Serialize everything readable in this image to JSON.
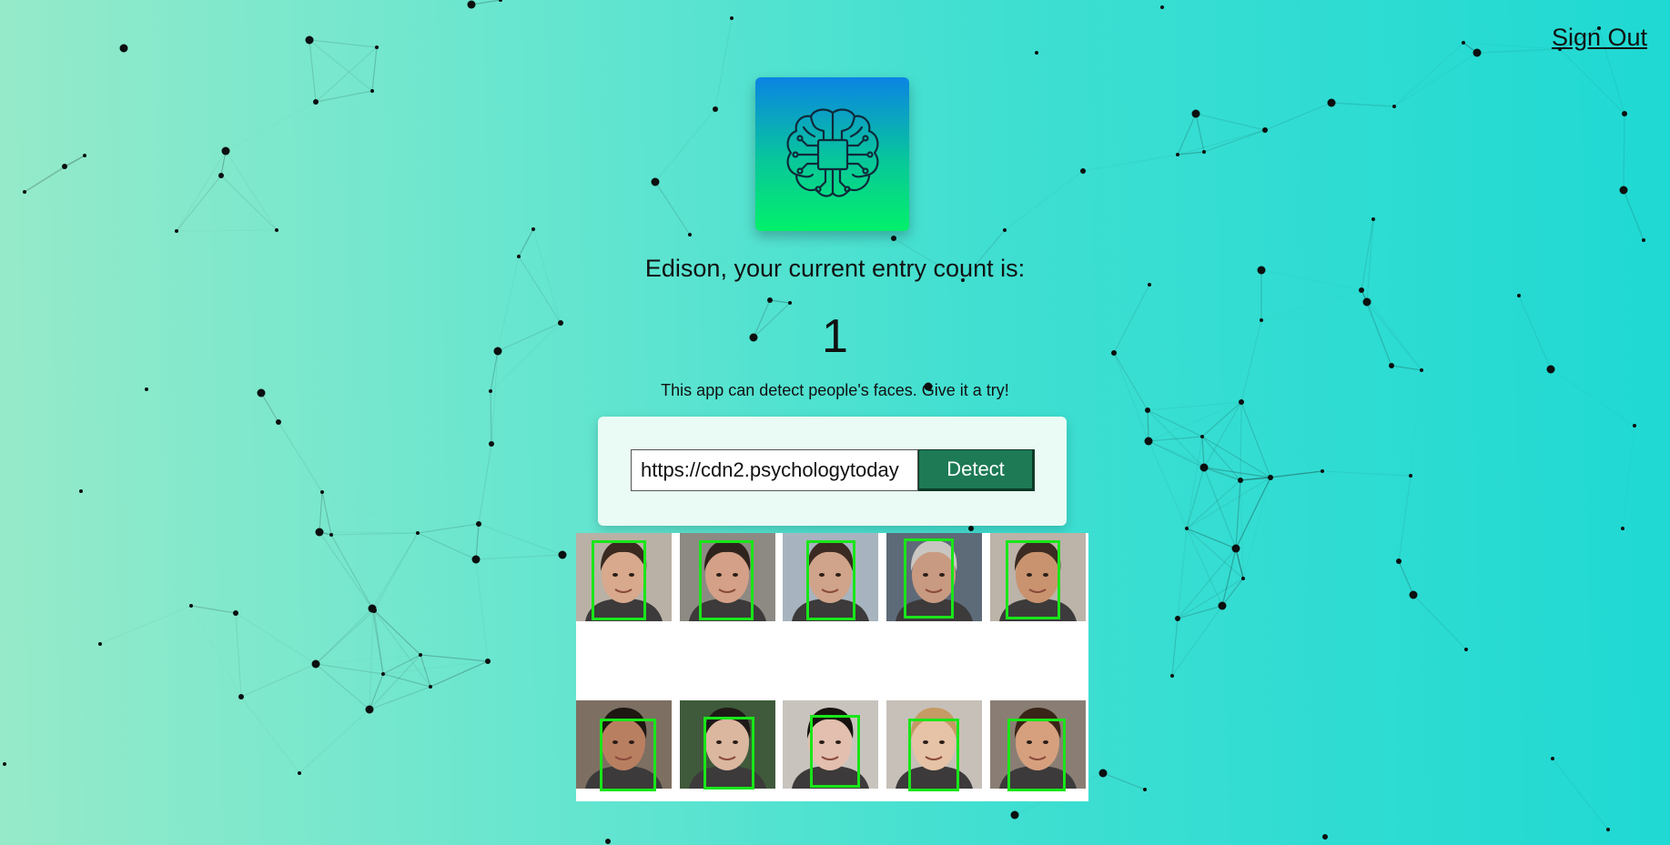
{
  "header": {
    "sign_out_label": "Sign Out"
  },
  "logo": {
    "icon": "brain-chip-icon",
    "gradient_top": "#0b84e3",
    "gradient_bottom": "#02f06a"
  },
  "entry": {
    "greeting": "Edison, your current entry count is:",
    "count": "1"
  },
  "tagline": "This app can detect people's faces. Give it a try!",
  "form": {
    "url_value": "https://cdn2.psychologytoday",
    "detect_label": "Detect",
    "button_color": "#1d7a55"
  },
  "result_image": {
    "face_box_color": "#19e619",
    "faces_detected": 10
  }
}
